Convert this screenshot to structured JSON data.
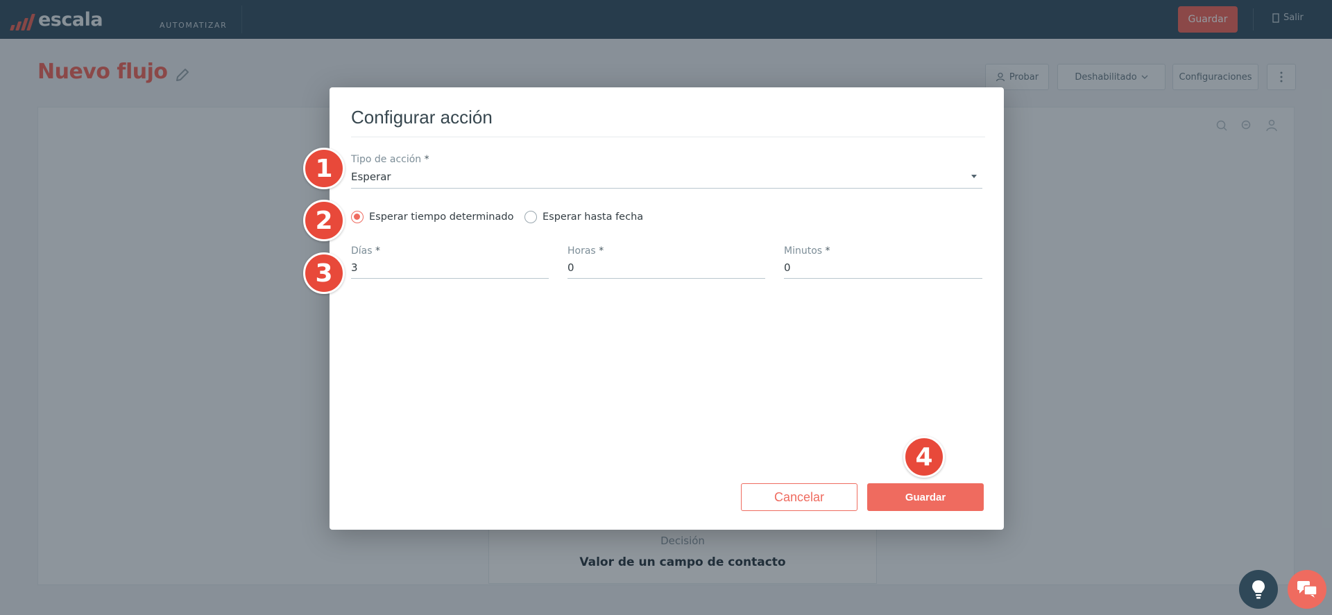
{
  "app": {
    "brand": "escala",
    "section": "AUTOMATIZAR",
    "save_label": "Guardar",
    "exit_label": "Salir"
  },
  "page": {
    "title": "Nuevo flujo",
    "test_label": "Probar",
    "status_label": "Deshabilitado",
    "settings_label": "Configuraciones"
  },
  "canvas": {
    "node_type": "Decisión",
    "node_name": "Valor de un campo de contacto"
  },
  "dialog": {
    "title": "Configurar acción",
    "action_type": {
      "label": "Tipo de acción",
      "required_mark": "*",
      "value": "Esperar"
    },
    "wait_options": [
      {
        "label": "Esperar tiempo determinado",
        "selected": true
      },
      {
        "label": "Esperar hasta fecha",
        "selected": false
      }
    ],
    "fields": {
      "days": {
        "label": "Días",
        "required_mark": "*",
        "value": "3"
      },
      "hours": {
        "label": "Horas",
        "required_mark": "*",
        "value": "0"
      },
      "minutes": {
        "label": "Minutos",
        "required_mark": "*",
        "value": "0"
      }
    },
    "cancel_label": "Cancelar",
    "save_label": "Guardar"
  },
  "steps": [
    "1",
    "2",
    "3",
    "4"
  ],
  "colors": {
    "accent": "#ef6b5f",
    "step_marker": "#e8493a",
    "topbar": "#3a5566"
  },
  "icons": [
    "edit-pencil-icon",
    "user-icon",
    "chevron-down-icon",
    "more-vertical-icon",
    "zoom-in-icon",
    "zoom-out-icon",
    "account-icon",
    "lightbulb-icon",
    "chat-icon",
    "exit-icon"
  ]
}
